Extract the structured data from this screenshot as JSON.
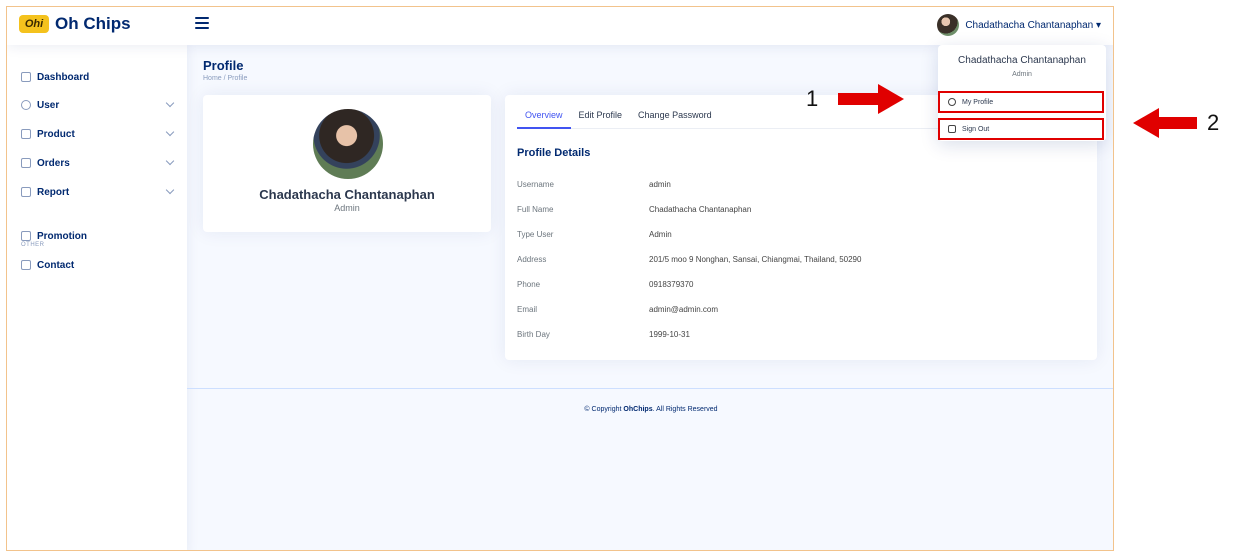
{
  "brand": {
    "logo_mark": "Ohi",
    "name": "Oh Chips"
  },
  "header": {
    "user_name": "Chadathacha Chantanaphan ▾"
  },
  "sidebar": {
    "items": [
      {
        "label": "Dashboard"
      },
      {
        "label": "User"
      },
      {
        "label": "Product"
      },
      {
        "label": "Orders"
      },
      {
        "label": "Report"
      },
      {
        "label": "Promotion"
      },
      {
        "label": "Contact"
      }
    ],
    "heading": "OTHER"
  },
  "page": {
    "title": "Profile",
    "breadcrumb": "Home / Profile"
  },
  "profile_card": {
    "name": "Chadathacha Chantanaphan",
    "role": "Admin"
  },
  "tabs": [
    {
      "label": "Overview"
    },
    {
      "label": "Edit Profile"
    },
    {
      "label": "Change Password"
    }
  ],
  "details": {
    "title": "Profile Details",
    "rows": [
      {
        "label": "Username",
        "value": "admin"
      },
      {
        "label": "Full Name",
        "value": "Chadathacha Chantanaphan"
      },
      {
        "label": "Type User",
        "value": "Admin"
      },
      {
        "label": "Address",
        "value": "201/5 moo 9 Nonghan, Sansai, Chiangmai, Thailand, 50290"
      },
      {
        "label": "Phone",
        "value": "0918379370"
      },
      {
        "label": "Email",
        "value": "admin@admin.com"
      },
      {
        "label": "Birth Day",
        "value": "1999-10-31"
      }
    ]
  },
  "footer": {
    "prefix": "© Copyright ",
    "brand": "OhChips",
    "suffix": ". All Rights Reserved"
  },
  "dropdown": {
    "name": "Chadathacha Chantanaphan",
    "role": "Admin",
    "my_profile": "My Profile",
    "sign_out": "Sign Out"
  },
  "annotations": {
    "one": "1",
    "two": "2"
  },
  "colors": {
    "primary": "#012970",
    "accent": "#4154f1",
    "highlight": "#e00000",
    "logo": "#f4c21d"
  }
}
